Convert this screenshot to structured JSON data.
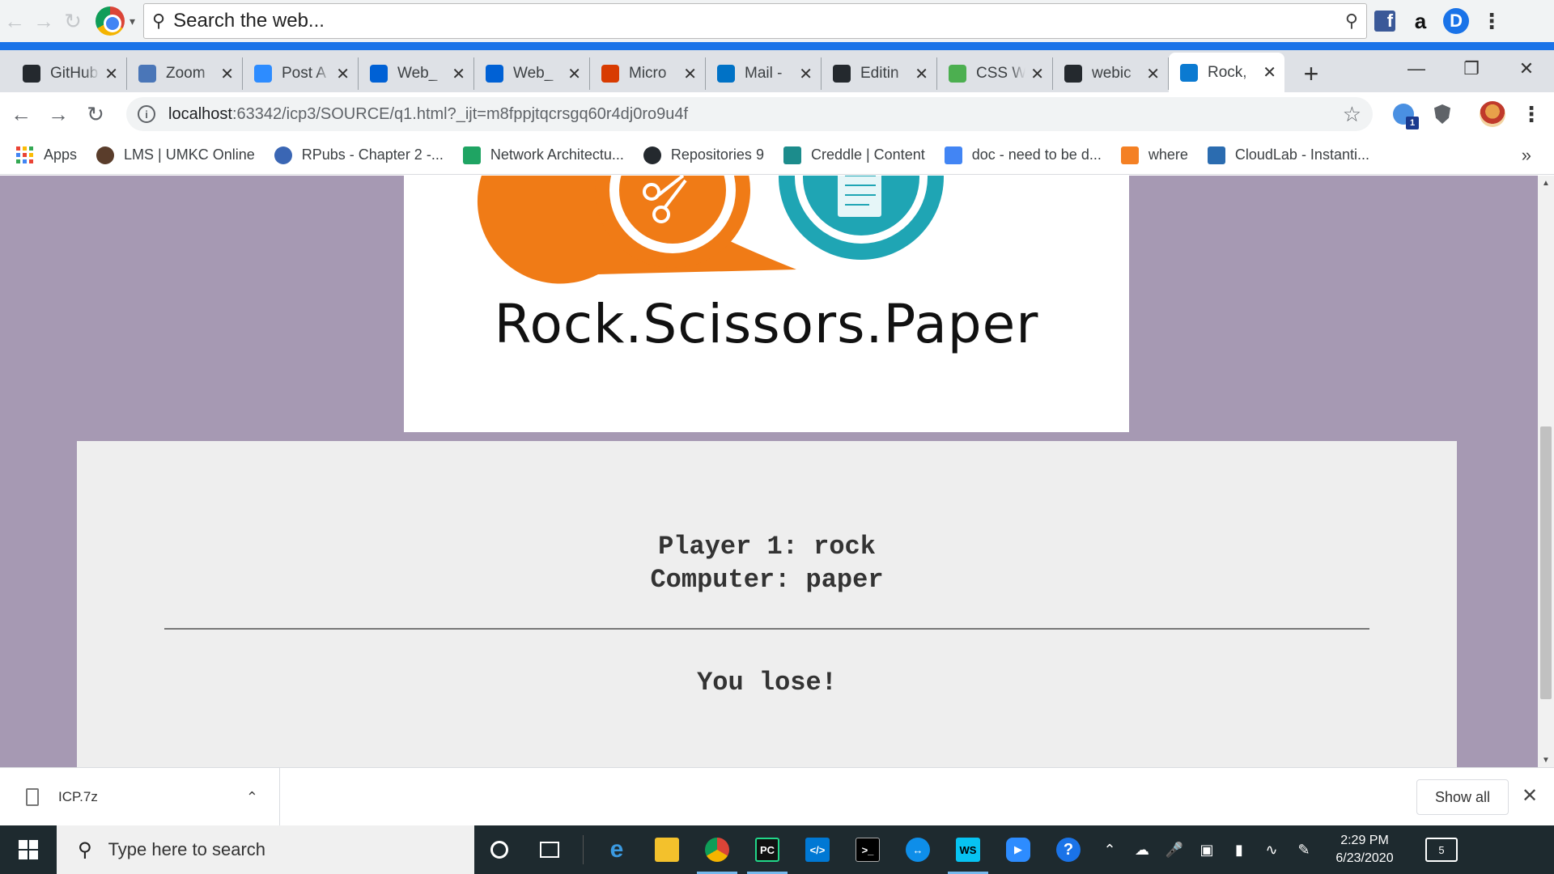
{
  "toolbar": {
    "search_placeholder": "Search the web...",
    "fb_label": "f",
    "amazon_label": "a",
    "profile_letter": "D"
  },
  "tabs": [
    {
      "label": "GitHub",
      "icon": "github-icon",
      "color": "#24292e"
    },
    {
      "label": "Zoom",
      "icon": "umkc-icon",
      "color": "#4a76b8"
    },
    {
      "label": "Post A",
      "icon": "zoom-icon",
      "color": "#2d8cff"
    },
    {
      "label": "Web_",
      "icon": "box-icon",
      "color": "#0061d5"
    },
    {
      "label": "Web_",
      "icon": "box-icon",
      "color": "#0061d5"
    },
    {
      "label": "Micro",
      "icon": "office-icon",
      "color": "#d83b01"
    },
    {
      "label": "Mail -",
      "icon": "outlook-icon",
      "color": "#0072c6"
    },
    {
      "label": "Editin",
      "icon": "github-icon",
      "color": "#24292e"
    },
    {
      "label": "CSS W",
      "icon": "w3-icon",
      "color": "#4caf50"
    },
    {
      "label": "webic",
      "icon": "github-icon",
      "color": "#24292e"
    },
    {
      "label": "Rock,",
      "icon": "webstorm-icon",
      "color": "#0b7ad1",
      "active": true
    }
  ],
  "address": {
    "host": "localhost",
    "path": ":63342/icp3/SOURCE/q1.html?_ijt=m8fppjtqcrsgq60r4dj0ro9u4f"
  },
  "bookmarks": [
    {
      "label": "Apps",
      "icon": "apps-grid-icon"
    },
    {
      "label": "LMS | UMKC Online",
      "icon": "lms-icon",
      "color": "#5a3d2b"
    },
    {
      "label": "RPubs - Chapter 2 -...",
      "icon": "rpubs-icon",
      "color": "#3a66b4"
    },
    {
      "label": "Network Architectu...",
      "icon": "google-drive-icon",
      "color": "#1fa463"
    },
    {
      "label": "Repositories 9",
      "icon": "github-icon",
      "color": "#24292e"
    },
    {
      "label": "Creddle | Content",
      "icon": "creddle-icon",
      "color": "#1c8c8c"
    },
    {
      "label": "doc - need to be d...",
      "icon": "google-docs-icon",
      "color": "#4285f4"
    },
    {
      "label": "where",
      "icon": "stackoverflow-icon",
      "color": "#f48024"
    },
    {
      "label": "CloudLab - Instanti...",
      "icon": "cloudlab-icon",
      "color": "#2b6cb0"
    }
  ],
  "page": {
    "logo_text": "Rock.Scissors.Paper",
    "player_line": "Player 1: rock",
    "computer_line": "Computer: paper",
    "outcome": "You lose!"
  },
  "downloads": {
    "file": "ICP.7z",
    "show_all": "Show all"
  },
  "taskbar": {
    "search_placeholder": "Type here to search",
    "time": "2:29 PM",
    "date": "6/23/2020",
    "notification_count": "5"
  },
  "colors": {
    "page_background": "#a699b3",
    "panel_background": "#eeeeee",
    "logo_orange": "#f07b16",
    "logo_teal": "#1fa5b4",
    "chrome_blue": "#1a73e8"
  }
}
